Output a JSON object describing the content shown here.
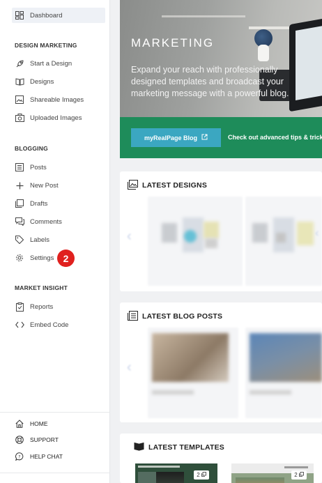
{
  "sidebar": {
    "dashboard": "Dashboard",
    "sections": {
      "design_marketing": "DESIGN MARKETING",
      "blogging": "BLOGGING",
      "market_insight": "MARKET INSIGHT"
    },
    "design_items": {
      "start": "Start a Design",
      "designs": "Designs",
      "shareable": "Shareable Images",
      "uploaded": "Uploaded Images"
    },
    "blog_items": {
      "posts": "Posts",
      "new_post": "New Post",
      "drafts": "Drafts",
      "comments": "Comments",
      "labels": "Labels",
      "settings": "Settings"
    },
    "insight_items": {
      "reports": "Reports",
      "embed": "Embed Code"
    },
    "bottom": {
      "home": "HOME",
      "support": "SUPPORT",
      "help": "HELP CHAT"
    },
    "step_badge": "2"
  },
  "hero": {
    "title": "MARKETING",
    "line1": "Expand your reach with professionally",
    "line2": "designed templates and broadcast your",
    "line3": "marketing message with a powerful blog.",
    "button": "myRealPage Blog",
    "tagline": "Check out advanced tips & tricks"
  },
  "panels": {
    "latest_designs": "LATEST DESIGNS",
    "latest_posts": "LATEST BLOG POSTS",
    "latest_templates": "LATEST TEMPLATES"
  },
  "templates": {
    "card1_count": "2",
    "card2_count": "2"
  },
  "colors": {
    "accent_green": "#1e8c5a",
    "button_blue": "#3ba7c1",
    "badge_red": "#e0201e"
  }
}
